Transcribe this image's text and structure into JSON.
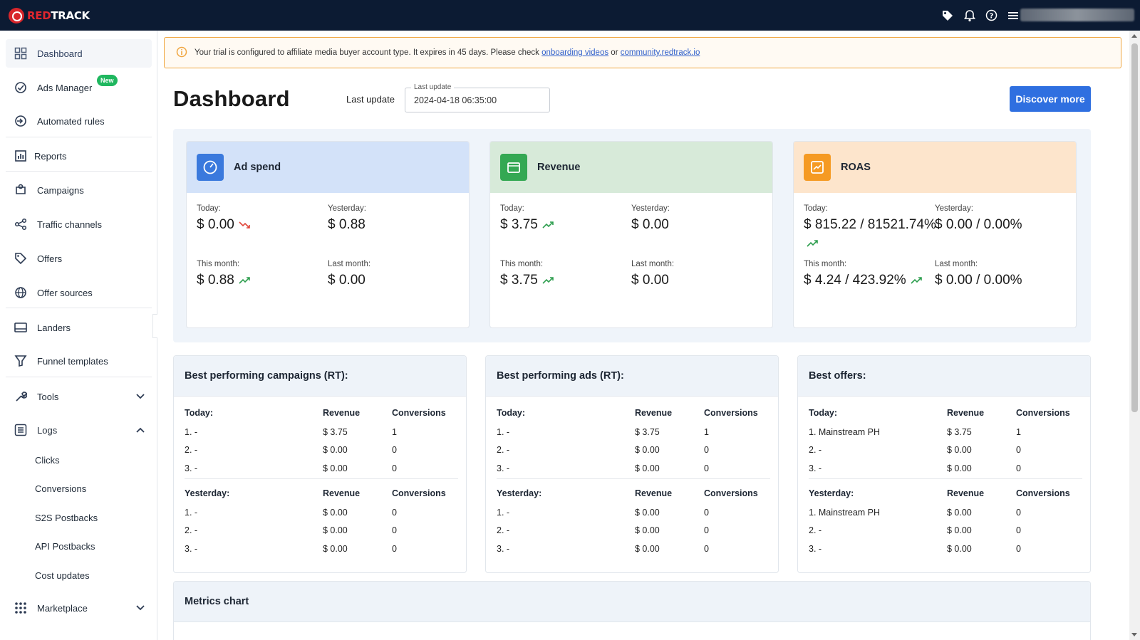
{
  "app": {
    "logo_red": "RED",
    "logo_white": "TRACK"
  },
  "topbar": {
    "icons": [
      "tag-icon",
      "bell-icon",
      "help-icon",
      "menu-icon"
    ]
  },
  "sidebar": {
    "items": [
      {
        "label": "Dashboard",
        "icon": "dashboard-icon"
      },
      {
        "label": "Ads Manager",
        "icon": "ads-manager-icon",
        "badge": "New"
      },
      {
        "label": "Automated rules",
        "icon": "automated-rules-icon"
      },
      {
        "label": "Reports",
        "icon": "reports-icon"
      },
      {
        "label": "Campaigns",
        "icon": "campaigns-icon"
      },
      {
        "label": "Traffic channels",
        "icon": "traffic-channels-icon"
      },
      {
        "label": "Offers",
        "icon": "offers-icon"
      },
      {
        "label": "Offer sources",
        "icon": "offer-sources-icon"
      },
      {
        "label": "Landers",
        "icon": "landers-icon"
      },
      {
        "label": "Funnel templates",
        "icon": "funnel-icon"
      },
      {
        "label": "Tools",
        "icon": "tools-icon"
      },
      {
        "label": "Logs",
        "icon": "logs-icon"
      },
      {
        "label": "Marketplace",
        "icon": "marketplace-icon"
      }
    ],
    "logs_sub": [
      "Clicks",
      "Conversions",
      "S2S Postbacks",
      "API Postbacks",
      "Cost updates"
    ]
  },
  "alert": {
    "text": "Your trial is configured to affiliate media buyer account type. It expires in 45 days. Please check ",
    "link1": "onboarding videos",
    "mid": " or ",
    "link2": "community.redtrack.io"
  },
  "header": {
    "title": "Dashboard",
    "last_update_label": "Last update",
    "field_label": "Last update",
    "field_value": "2024-04-18 06:35:00",
    "discover_button": "Discover more"
  },
  "cards": {
    "ad_spend": {
      "title": "Ad spend",
      "color": "#d3e2f9",
      "icon_bg": "#3a79dd",
      "today_label": "Today:",
      "today": "$ 0.00",
      "yesterday_label": "Yesterday:",
      "yesterday": "$ 0.88",
      "month_label": "This month:",
      "month": "$ 0.88",
      "last_month_label": "Last month:",
      "last_month": "$ 0.00"
    },
    "revenue": {
      "title": "Revenue",
      "color": "#d7ead9",
      "icon_bg": "#34a853",
      "today_label": "Today:",
      "today": "$ 3.75",
      "yesterday_label": "Yesterday:",
      "yesterday": "$ 0.00",
      "month_label": "This month:",
      "month": "$ 3.75",
      "last_month_label": "Last month:",
      "last_month": "$ 0.00"
    },
    "roas": {
      "title": "ROAS",
      "color": "#fde5cc",
      "icon_bg": "#f59a23",
      "today_label": "Today:",
      "today": "$ 815.22 / 81521.74%",
      "yesterday_label": "Yesterday:",
      "yesterday": "$ 0.00 / 0.00%",
      "month_label": "This month:",
      "month": "$ 4.24 / 423.92%",
      "last_month_label": "Last month:",
      "last_month": "$ 0.00 / 0.00%"
    }
  },
  "panels": [
    {
      "title": "Best performing campaigns (RT):",
      "today": {
        "label": "Today:",
        "revenue_h": "Revenue",
        "conv_h": "Conversions",
        "rows": [
          [
            "1. -",
            "$ 3.75",
            "1"
          ],
          [
            "2. -",
            "$ 0.00",
            "0"
          ],
          [
            "3. -",
            "$ 0.00",
            "0"
          ]
        ]
      },
      "yesterday": {
        "label": "Yesterday:",
        "revenue_h": "Revenue",
        "conv_h": "Conversions",
        "rows": [
          [
            "1. -",
            "$ 0.00",
            "0"
          ],
          [
            "2. -",
            "$ 0.00",
            "0"
          ],
          [
            "3. -",
            "$ 0.00",
            "0"
          ]
        ]
      }
    },
    {
      "title": "Best performing ads (RT):",
      "today": {
        "label": "Today:",
        "revenue_h": "Revenue",
        "conv_h": "Conversions",
        "rows": [
          [
            "1. -",
            "$ 3.75",
            "1"
          ],
          [
            "2. -",
            "$ 0.00",
            "0"
          ],
          [
            "3. -",
            "$ 0.00",
            "0"
          ]
        ]
      },
      "yesterday": {
        "label": "Yesterday:",
        "revenue_h": "Revenue",
        "conv_h": "Conversions",
        "rows": [
          [
            "1. -",
            "$ 0.00",
            "0"
          ],
          [
            "2. -",
            "$ 0.00",
            "0"
          ],
          [
            "3. -",
            "$ 0.00",
            "0"
          ]
        ]
      }
    },
    {
      "title": "Best offers:",
      "today": {
        "label": "Today:",
        "revenue_h": "Revenue",
        "conv_h": "Conversions",
        "rows": [
          [
            "1. Mainstream PH",
            "$ 3.75",
            "1"
          ],
          [
            "2. -",
            "$ 0.00",
            "0"
          ],
          [
            "3. -",
            "$ 0.00",
            "0"
          ]
        ]
      },
      "yesterday": {
        "label": "Yesterday:",
        "revenue_h": "Revenue",
        "conv_h": "Conversions",
        "rows": [
          [
            "1. Mainstream PH",
            "$ 0.00",
            "0"
          ],
          [
            "2. -",
            "$ 0.00",
            "0"
          ],
          [
            "3. -",
            "$ 0.00",
            "0"
          ]
        ]
      }
    }
  ],
  "metrics_chart": {
    "title": "Metrics chart"
  }
}
